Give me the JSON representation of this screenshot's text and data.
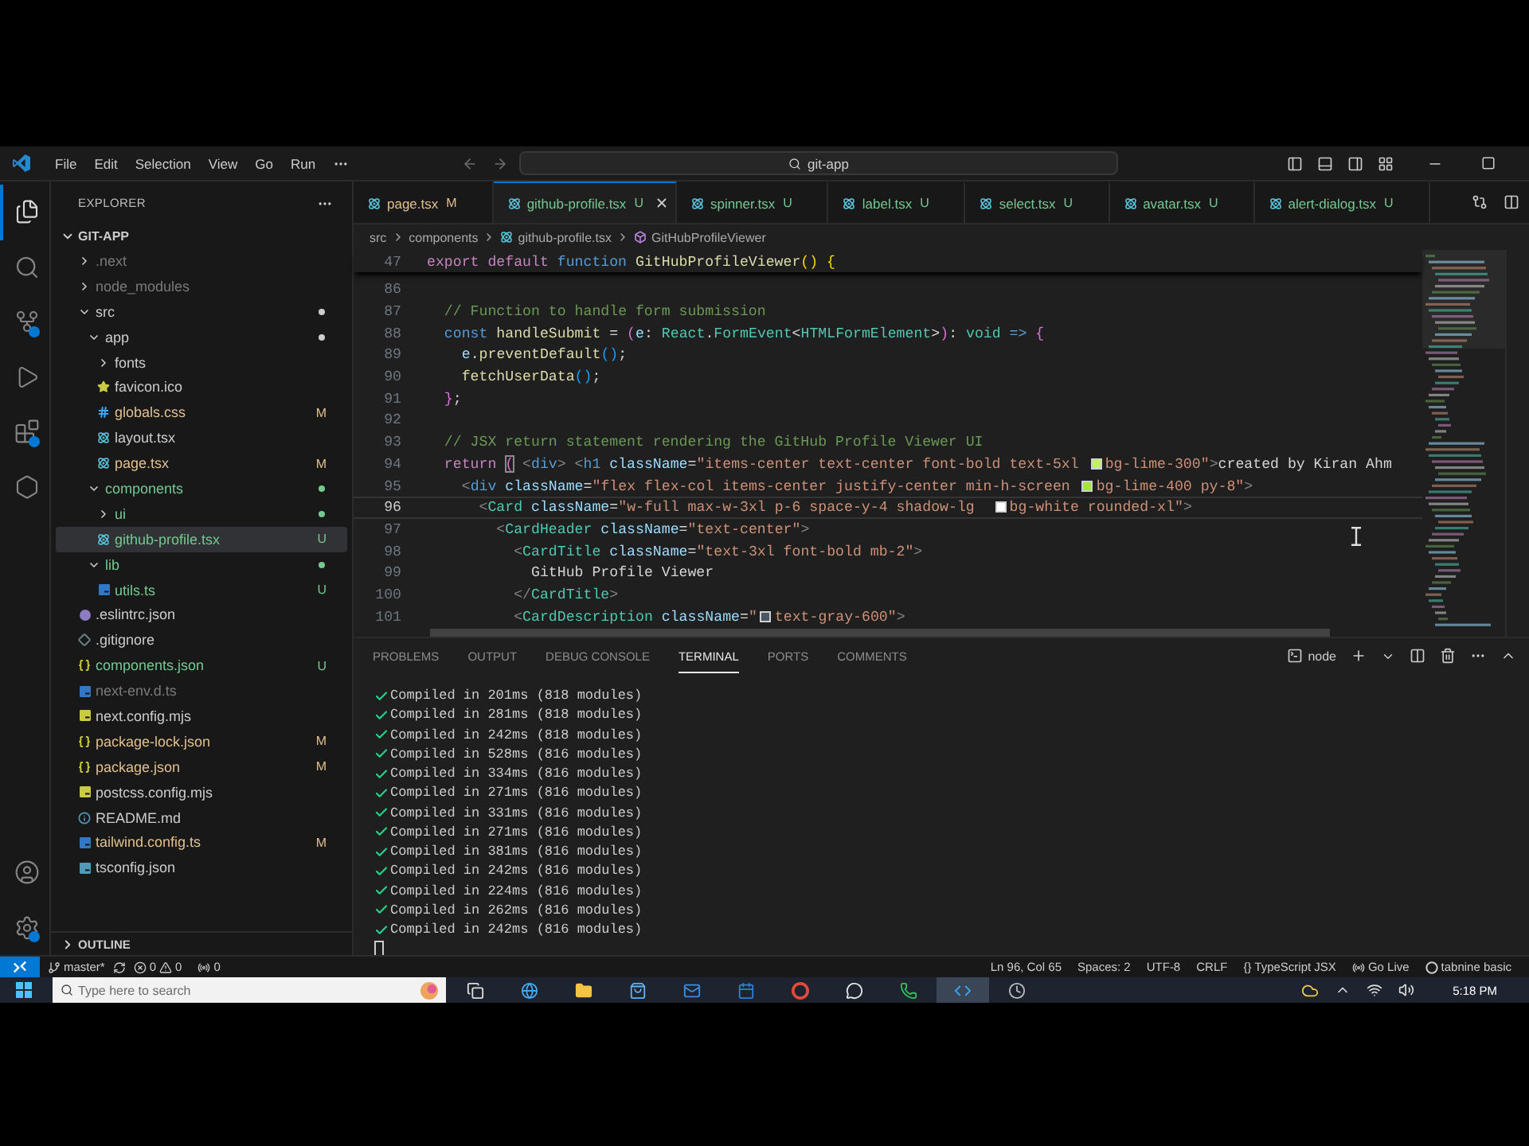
{
  "title_bar": {
    "menus": [
      "File",
      "Edit",
      "Selection",
      "View",
      "Go",
      "Run"
    ],
    "command_center": "git-app"
  },
  "activity_bar": {
    "top": [
      {
        "kind": "explorer",
        "selected": true,
        "badge": false
      },
      {
        "kind": "search",
        "selected": false,
        "badge": false
      },
      {
        "kind": "scm",
        "selected": false,
        "badge": true
      },
      {
        "kind": "debug",
        "selected": false,
        "badge": false
      },
      {
        "kind": "extensions",
        "selected": false,
        "badge": true
      },
      {
        "kind": "remote",
        "selected": false,
        "badge": false
      }
    ],
    "bottom": [
      {
        "kind": "account",
        "badge": false
      },
      {
        "kind": "settings",
        "badge": true
      }
    ]
  },
  "sidebar": {
    "title": "EXPLORER",
    "tree": {
      "label": "GIT-APP",
      "expanded": true,
      "items": [
        {
          "label": ".next",
          "kind": "folder",
          "expanded": false,
          "color": "#7a7a7a",
          "dot": false,
          "selected": false
        },
        {
          "label": "node_modules",
          "kind": "folder",
          "expanded": false,
          "color": "#7a7a7a",
          "dot": false,
          "selected": false
        },
        {
          "label": "src",
          "kind": "folder",
          "expanded": true,
          "color": "#cccccc",
          "dot": true,
          "selected": false,
          "children": [
            {
              "label": "app",
              "kind": "folder",
              "expanded": true,
              "color": "#cccccc",
              "dot": true,
              "selected": false,
              "children": [
                {
                  "label": "fonts",
                  "kind": "folder",
                  "expanded": false,
                  "color": "#cccccc",
                  "dot": false,
                  "selected": false
                },
                {
                  "label": "favicon.ico",
                  "kind": "ico",
                  "color": "#cccccc",
                  "selected": false
                },
                {
                  "label": "globals.css",
                  "kind": "css",
                  "color": "#e2c08d",
                  "badge": "M",
                  "selected": false
                },
                {
                  "label": "layout.tsx",
                  "kind": "react",
                  "color": "#cccccc",
                  "selected": false
                },
                {
                  "label": "page.tsx",
                  "kind": "react",
                  "color": "#e2c08d",
                  "badge": "M",
                  "selected": false
                }
              ]
            },
            {
              "label": "components",
              "kind": "folder",
              "expanded": true,
              "color": "#73c991",
              "dot": true,
              "selected": false,
              "children": [
                {
                  "label": "ui",
                  "kind": "folder",
                  "expanded": false,
                  "color": "#73c991",
                  "dot": true,
                  "selected": false
                },
                {
                  "label": "github-profile.tsx",
                  "kind": "react",
                  "color": "#73c991",
                  "badge": "U",
                  "selected": true
                }
              ]
            },
            {
              "label": "lib",
              "kind": "folder",
              "expanded": true,
              "color": "#73c991",
              "dot": true,
              "selected": false,
              "children": [
                {
                  "label": "utils.ts",
                  "kind": "ts",
                  "color": "#73c991",
                  "badge": "U",
                  "selected": false
                }
              ]
            }
          ]
        },
        {
          "label": ".eslintrc.json",
          "kind": "eslint",
          "color": "#cccccc",
          "selected": false
        },
        {
          "label": ".gitignore",
          "kind": "git",
          "color": "#cccccc",
          "selected": false
        },
        {
          "label": "components.json",
          "kind": "json",
          "color": "#73c991",
          "badge": "U",
          "selected": false
        },
        {
          "label": "next-env.d.ts",
          "kind": "ts",
          "color": "#7a7a7a",
          "selected": false
        },
        {
          "label": "next.config.mjs",
          "kind": "js",
          "color": "#cccccc",
          "selected": false
        },
        {
          "label": "package-lock.json",
          "kind": "json",
          "color": "#e2c08d",
          "badge": "M",
          "selected": false
        },
        {
          "label": "package.json",
          "kind": "json",
          "color": "#e2c08d",
          "badge": "M",
          "selected": false
        },
        {
          "label": "postcss.config.mjs",
          "kind": "js",
          "color": "#cccccc",
          "selected": false
        },
        {
          "label": "README.md",
          "kind": "md",
          "color": "#cccccc",
          "selected": false
        },
        {
          "label": "tailwind.config.ts",
          "kind": "ts",
          "color": "#e2c08d",
          "badge": "M",
          "selected": false
        },
        {
          "label": "tsconfig.json",
          "kind": "config",
          "color": "#cccccc",
          "selected": false
        }
      ]
    },
    "outline": {
      "label": "OUTLINE",
      "expanded": false
    }
  },
  "tabs": [
    {
      "label": "page.tsx",
      "badge": "M",
      "color": "#e2c08d",
      "selected": false
    },
    {
      "label": "github-profile.tsx",
      "badge": "U",
      "color": "#73c991",
      "selected": true
    },
    {
      "label": "spinner.tsx",
      "badge": "U",
      "color": "#73c991",
      "selected": false
    },
    {
      "label": "label.tsx",
      "badge": "U",
      "color": "#73c991",
      "selected": false
    },
    {
      "label": "select.tsx",
      "badge": "U",
      "color": "#73c991",
      "selected": false
    },
    {
      "label": "avatar.tsx",
      "badge": "U",
      "color": "#73c991",
      "selected": false
    },
    {
      "label": "alert-dialog.tsx",
      "badge": "U",
      "color": "#73c991",
      "selected": false
    }
  ],
  "breadcrumbs": [
    {
      "label": "src",
      "kind": "folder"
    },
    {
      "label": "components",
      "kind": "folder"
    },
    {
      "label": "github-profile.tsx",
      "kind": "file"
    },
    {
      "label": "GitHubProfileViewer",
      "kind": "symbol"
    }
  ],
  "editor": {
    "sticky": {
      "number": "47",
      "tokens": [
        {
          "kind": "keyword",
          "text": "export default "
        },
        {
          "kind": "storage",
          "text": "function "
        },
        {
          "kind": "function",
          "text": "GitHubProfileViewer"
        },
        {
          "kind": "bracket",
          "text": "() {"
        }
      ]
    },
    "lines": [
      {
        "number": "86",
        "active": false
      },
      {
        "number": "87",
        "active": false,
        "tokens": [
          {
            "kind": "comment",
            "text": "  // Function to handle form submission"
          }
        ]
      },
      {
        "number": "88",
        "active": false,
        "tokens": [
          {
            "kind": "storage",
            "text": "  const"
          },
          {
            "kind": "function",
            "text": " handleSubmit"
          },
          {
            "kind": "punct",
            "text": " = "
          },
          {
            "kind": "bracket2",
            "text": "("
          },
          {
            "kind": "variable",
            "text": "e"
          },
          {
            "kind": "punct",
            "text": ": "
          },
          {
            "kind": "type",
            "text": "React"
          },
          {
            "kind": "punct",
            "text": "."
          },
          {
            "kind": "type",
            "text": "FormEvent"
          },
          {
            "kind": "punct",
            "text": "<"
          },
          {
            "kind": "type",
            "text": "HTMLFormElement"
          },
          {
            "kind": "punct",
            "text": ">"
          },
          {
            "kind": "bracket2",
            "text": ")"
          },
          {
            "kind": "punct",
            "text": ": "
          },
          {
            "kind": "type",
            "text": "void"
          },
          {
            "kind": "storage",
            "text": " => "
          },
          {
            "kind": "bracket2",
            "text": "{"
          }
        ]
      },
      {
        "number": "89",
        "active": false,
        "tokens": [
          {
            "kind": "variable",
            "text": "    e"
          },
          {
            "kind": "punct",
            "text": "."
          },
          {
            "kind": "function",
            "text": "preventDefault"
          },
          {
            "kind": "bracket3",
            "text": "()"
          },
          {
            "kind": "punct",
            "text": ";"
          }
        ]
      },
      {
        "number": "90",
        "active": false,
        "tokens": [
          {
            "kind": "function",
            "text": "    fetchUserData"
          },
          {
            "kind": "bracket3",
            "text": "()"
          },
          {
            "kind": "punct",
            "text": ";"
          }
        ]
      },
      {
        "number": "91",
        "active": false,
        "tokens": [
          {
            "kind": "bracket2",
            "text": "  }"
          },
          {
            "kind": "punct",
            "text": ";"
          }
        ]
      },
      {
        "number": "92",
        "active": false
      },
      {
        "number": "93",
        "active": false,
        "tokens": [
          {
            "kind": "comment",
            "text": "  // JSX return statement rendering the GitHub Profile Viewer UI"
          }
        ]
      },
      {
        "number": "94",
        "active": false,
        "tokens": [
          {
            "kind": "keyword",
            "text": "  return "
          },
          {
            "kind": "match",
            "text": "("
          },
          {
            "kind": "angle",
            "text": " <"
          },
          {
            "kind": "tag",
            "text": "div"
          },
          {
            "kind": "angle",
            "text": "> <"
          },
          {
            "kind": "tag",
            "text": "h1"
          },
          {
            "kind": "attr",
            "text": " className"
          },
          {
            "kind": "punct",
            "text": "="
          },
          {
            "kind": "string",
            "text": "\"items-center text-center font-bold text-5xl "
          },
          {
            "kind": "swatch",
            "color": "#bef264"
          },
          {
            "kind": "string",
            "text": "bg-lime-300\""
          },
          {
            "kind": "angle",
            "text": ">"
          },
          {
            "kind": "text",
            "text": "created by Kiran Ahm"
          }
        ]
      },
      {
        "number": "95",
        "active": false,
        "tokens": [
          {
            "kind": "angle",
            "text": "    <"
          },
          {
            "kind": "tag",
            "text": "div"
          },
          {
            "kind": "attr",
            "text": " className"
          },
          {
            "kind": "punct",
            "text": "="
          },
          {
            "kind": "string",
            "text": "\"flex flex-col items-center justify-center min-h-screen "
          },
          {
            "kind": "swatch",
            "color": "#a3e635"
          },
          {
            "kind": "string",
            "text": "bg-lime-400 py-8\""
          },
          {
            "kind": "angle",
            "text": ">"
          }
        ]
      },
      {
        "number": "96",
        "active": true,
        "tokens": [
          {
            "kind": "angle",
            "text": "      <"
          },
          {
            "kind": "component",
            "text": "Card"
          },
          {
            "kind": "attr",
            "text": " className"
          },
          {
            "kind": "punct",
            "text": "="
          },
          {
            "kind": "string",
            "text": "\"w-full max-w-3xl p-6 space-y-4 shadow-lg  "
          },
          {
            "kind": "swatch",
            "color": "#ffffff"
          },
          {
            "kind": "string",
            "text": "bg-white rounded-xl\""
          },
          {
            "kind": "angle",
            "text": ">"
          }
        ]
      },
      {
        "number": "97",
        "active": false,
        "tokens": [
          {
            "kind": "angle",
            "text": "        <"
          },
          {
            "kind": "component",
            "text": "CardHeader"
          },
          {
            "kind": "attr",
            "text": " className"
          },
          {
            "kind": "punct",
            "text": "="
          },
          {
            "kind": "string",
            "text": "\"text-center\""
          },
          {
            "kind": "angle",
            "text": ">"
          }
        ]
      },
      {
        "number": "98",
        "active": false,
        "tokens": [
          {
            "kind": "angle",
            "text": "          <"
          },
          {
            "kind": "component",
            "text": "CardTitle"
          },
          {
            "kind": "attr",
            "text": " className"
          },
          {
            "kind": "punct",
            "text": "="
          },
          {
            "kind": "string",
            "text": "\"text-3xl font-bold mb-2\""
          },
          {
            "kind": "angle",
            "text": ">"
          }
        ]
      },
      {
        "number": "99",
        "active": false,
        "tokens": [
          {
            "kind": "text",
            "text": "            GitHub Profile Viewer"
          }
        ]
      },
      {
        "number": "100",
        "active": false,
        "tokens": [
          {
            "kind": "angle",
            "text": "          </"
          },
          {
            "kind": "component",
            "text": "CardTitle"
          },
          {
            "kind": "angle",
            "text": ">"
          }
        ]
      },
      {
        "number": "101",
        "active": false,
        "tokens": [
          {
            "kind": "angle",
            "text": "          <"
          },
          {
            "kind": "component",
            "text": "CardDescription"
          },
          {
            "kind": "attr",
            "text": " className"
          },
          {
            "kind": "punct",
            "text": "="
          },
          {
            "kind": "string",
            "text": "\""
          },
          {
            "kind": "swatch",
            "color": "#4b5563"
          },
          {
            "kind": "string",
            "text": "text-gray-600\""
          },
          {
            "kind": "angle",
            "text": ">"
          }
        ]
      }
    ]
  },
  "panel": {
    "tabs": [
      {
        "label": "PROBLEMS",
        "selected": false
      },
      {
        "label": "OUTPUT",
        "selected": false
      },
      {
        "label": "DEBUG CONSOLE",
        "selected": false
      },
      {
        "label": "TERMINAL",
        "selected": true
      },
      {
        "label": "PORTS",
        "selected": false
      },
      {
        "label": "COMMENTS",
        "selected": false
      }
    ],
    "terminal": {
      "profile": "node",
      "lines": [
        "Compiled in 201ms (818 modules)",
        "Compiled in 281ms (818 modules)",
        "Compiled in 242ms (818 modules)",
        "Compiled in 528ms (816 modules)",
        "Compiled in 334ms (816 modules)",
        "Compiled in 271ms (816 modules)",
        "Compiled in 331ms (816 modules)",
        "Compiled in 271ms (816 modules)",
        "Compiled in 381ms (816 modules)",
        "Compiled in 242ms (816 modules)",
        "Compiled in 224ms (816 modules)",
        "Compiled in 262ms (816 modules)",
        "Compiled in 242ms (816 modules)"
      ]
    }
  },
  "status_bar": {
    "branch": "master*",
    "errors": "0",
    "warnings": "0",
    "ports": "0",
    "right": [
      {
        "kind": "plain",
        "text": "Ln 96, Col 65"
      },
      {
        "kind": "plain",
        "text": "Spaces: 2"
      },
      {
        "kind": "plain",
        "text": "UTF-8"
      },
      {
        "kind": "plain",
        "text": "CRLF"
      },
      {
        "kind": "plain",
        "text": "{} TypeScript JSX"
      },
      {
        "kind": "live",
        "text": "Go Live"
      },
      {
        "kind": "tabnine",
        "text": "tabnine basic"
      }
    ]
  },
  "taskbar": {
    "search": {
      "placeholder": "Type here to search"
    },
    "clock": "5:18 PM"
  }
}
